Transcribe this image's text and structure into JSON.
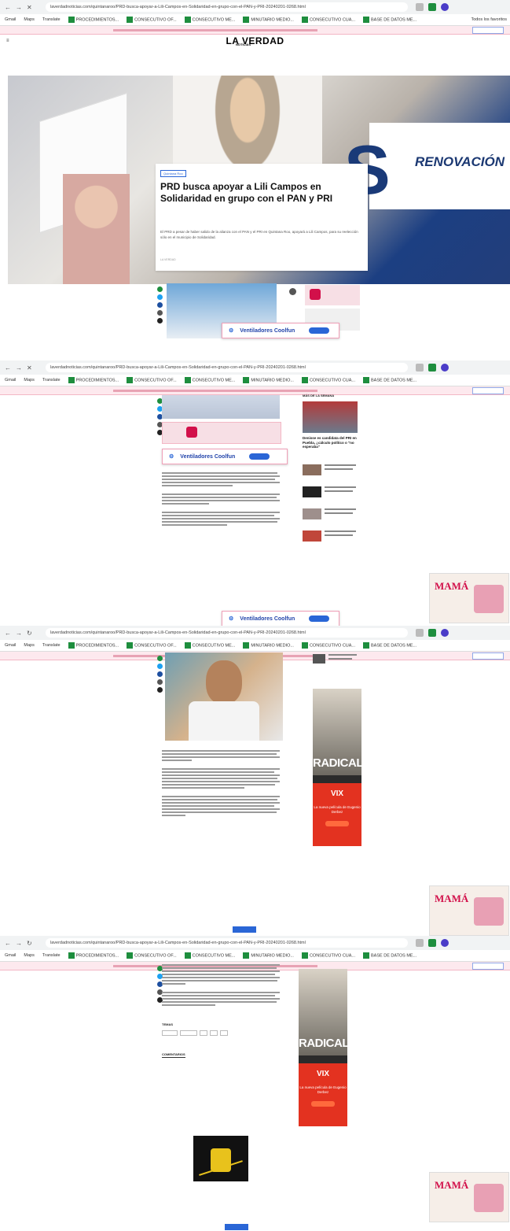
{
  "browser": {
    "url": "laverdadnoticias.com/quintanaroo/PRD-busca-apoyar-a-Lili-Campos-en-Solidaridad-en-grupo-con-el-PAN-y-PRI-20240201-0268.html",
    "bookmarks": [
      "Gmail",
      "Maps",
      "Translate",
      "PROCEDIMIENTOS...",
      "CONSECUTIVO OF...",
      "CONSECUTIVO ME...",
      "MINUTARIO MEDIO...",
      "CONSECUTIVO CUA...",
      "BASE DE DATOS ME..."
    ],
    "all_bookmarks": "Todos los favoritos"
  },
  "site": {
    "logo": "LA VERDAD",
    "logo_sub": "NOTICIAS"
  },
  "hero": {
    "sign_text": "RENOVACIÓN",
    "category": "Quintana Roo",
    "headline": "PRD busca apoyar a Lili Campos en Solidaridad en grupo con el PAN y PRI",
    "summary": "El PRD a pesar de haber salido de la alianza con el PAN y el PRI en Quintana Roo, apoyará a Lili Campos, para su reelección sólo en el municipio de Solidaridad.",
    "byline": "LA VERDAD"
  },
  "fan_ad": {
    "label": "Ventiladores Coolfun"
  },
  "sidebar": {
    "heading": "MÁS DE LA SEMANA",
    "lead_title": "Denisse es candidata del PRI en Puebla, ¿cálculo político o \"no esperaba\"",
    "ad_radical": "RADICAL",
    "ad_vix": "VIX",
    "ad_vix_sub": "La nueva película de Eugenio Derbez"
  },
  "mama_ad": {
    "title": "MAMÁ"
  },
  "tags": {
    "heading": "TEMAS",
    "comments": "COMENTARIOS"
  },
  "colors": {
    "accent": "#d2104a",
    "link_blue": "#2a66d6",
    "brand_green": "#1e8e3e"
  }
}
